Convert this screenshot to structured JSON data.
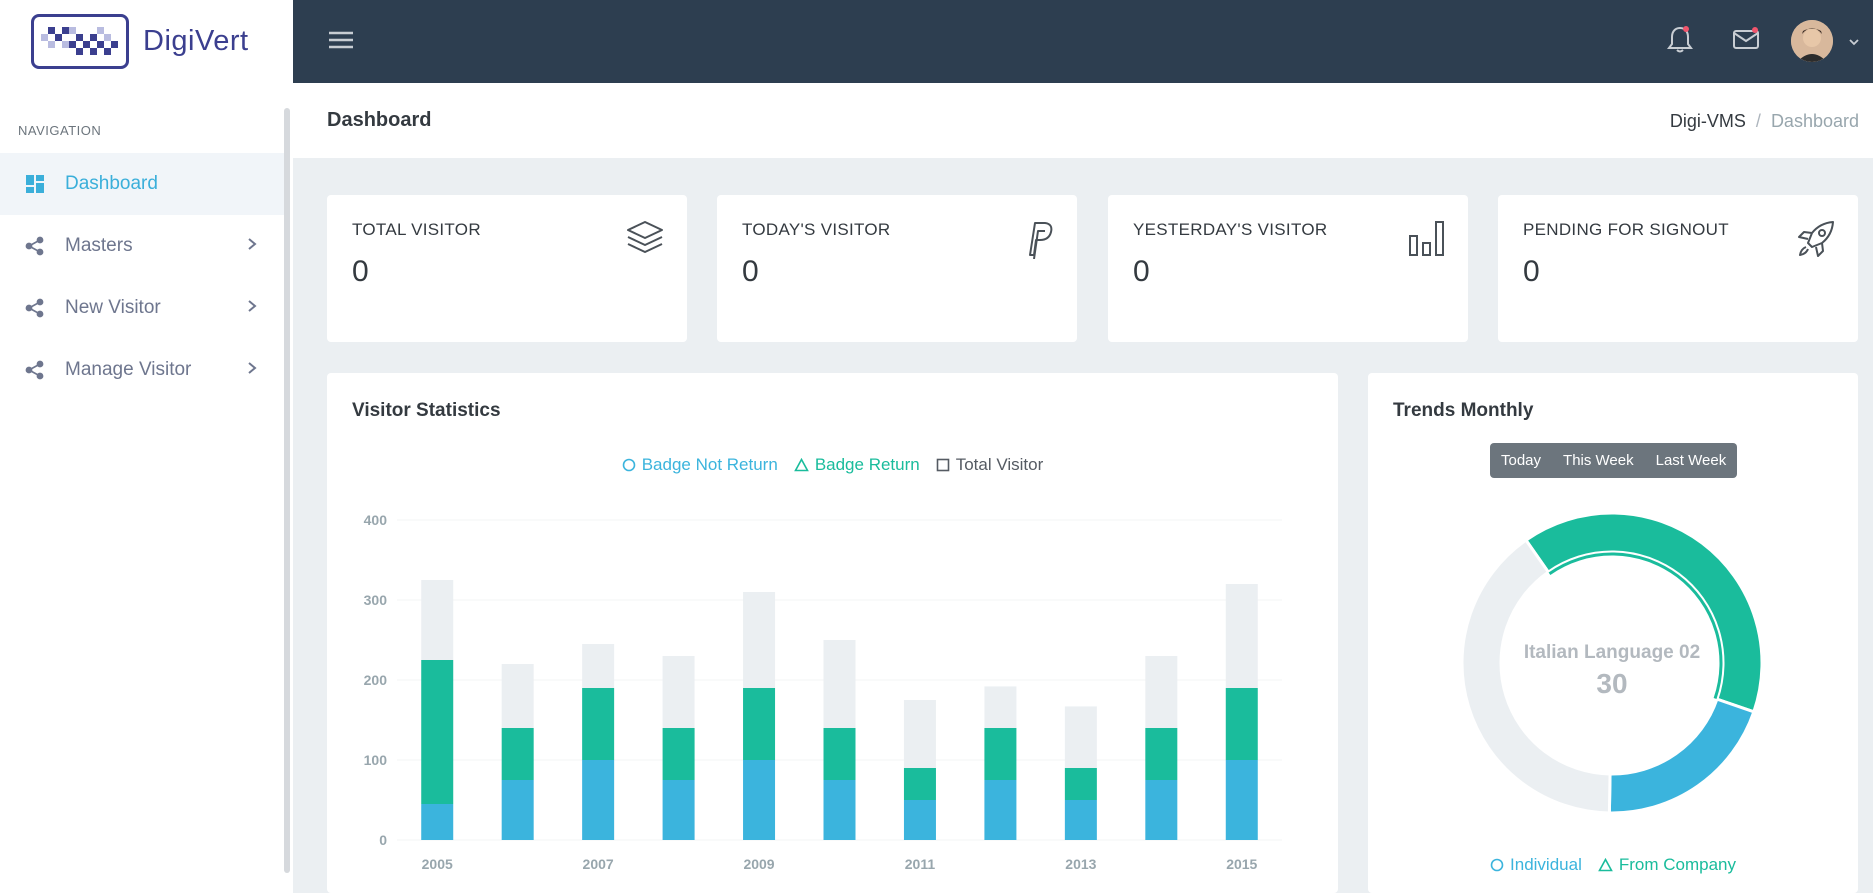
{
  "brand": {
    "name": "DigiVert"
  },
  "sidebar": {
    "section_title": "NAVIGATION",
    "items": [
      {
        "label": "Dashboard",
        "icon": "dashboard-icon",
        "active": true
      },
      {
        "label": "Masters",
        "icon": "share-icon",
        "active": false
      },
      {
        "label": "New Visitor",
        "icon": "share-icon",
        "active": false
      },
      {
        "label": "Manage Visitor",
        "icon": "share-icon",
        "active": false
      }
    ]
  },
  "topbar": {
    "icons": [
      "menu-icon",
      "bell-icon",
      "mail-icon",
      "avatar",
      "chevron-down-icon"
    ]
  },
  "page": {
    "title": "Dashboard",
    "breadcrumb": [
      "Digi-VMS",
      "Dashboard"
    ]
  },
  "stats": [
    {
      "label": "TOTAL VISITOR",
      "value": "0",
      "icon": "layers-icon"
    },
    {
      "label": "TODAY'S VISITOR",
      "value": "0",
      "icon": "paypal-icon"
    },
    {
      "label": "YESTERDAY'S VISITOR",
      "value": "0",
      "icon": "bar-chart-icon"
    },
    {
      "label": "PENDING FOR SIGNOUT",
      "value": "0",
      "icon": "rocket-icon"
    }
  ],
  "visitor_stats": {
    "title": "Visitor Statistics",
    "legend": [
      {
        "label": "Badge Not Return",
        "marker": "circle",
        "color": "#3bb4dd"
      },
      {
        "label": "Badge Return",
        "marker": "triangle",
        "color": "#1abc9c"
      },
      {
        "label": "Total Visitor",
        "marker": "square",
        "color": "#555b63"
      }
    ]
  },
  "trends": {
    "title": "Trends Monthly",
    "buttons": [
      "Today",
      "This Week",
      "Last Week"
    ],
    "center_label": "Italian Language 02",
    "center_value": "30",
    "legend": [
      {
        "label": "Individual",
        "marker": "circle",
        "color": "#3bb4dd"
      },
      {
        "label": "From Company",
        "marker": "triangle",
        "color": "#1abc9c"
      }
    ]
  },
  "chart_data": [
    {
      "type": "bar",
      "stacked": true,
      "title": "Visitor Statistics",
      "categories": [
        "2005",
        "2006",
        "2007",
        "2008",
        "2009",
        "2010",
        "2011",
        "2012",
        "2013",
        "2014",
        "2015"
      ],
      "tick_labels_x": [
        "2005",
        "2007",
        "2009",
        "2011",
        "2013",
        "2015"
      ],
      "yticks": [
        0,
        100,
        200,
        300,
        400
      ],
      "ylim": [
        0,
        400
      ],
      "series": [
        {
          "name": "Badge Not Return",
          "color": "#3bb4dd",
          "values": [
            45,
            75,
            100,
            75,
            100,
            75,
            50,
            75,
            50,
            75,
            100
          ]
        },
        {
          "name": "Badge Return",
          "color": "#1abc9c",
          "values": [
            180,
            65,
            90,
            65,
            90,
            65,
            40,
            65,
            40,
            65,
            90
          ]
        },
        {
          "name": "Total Visitor",
          "color": "#ebeff2",
          "values": [
            100,
            80,
            55,
            90,
            120,
            110,
            85,
            52,
            77,
            90,
            130
          ]
        }
      ],
      "legend": "top-center"
    },
    {
      "type": "pie",
      "donut": true,
      "title": "Trends Monthly",
      "slices": [
        {
          "name": "Individual",
          "value": 20,
          "color": "#3bb4dd"
        },
        {
          "name": "From Company",
          "value": 40,
          "color": "#1abc9c"
        },
        {
          "name": "Other",
          "value": 40,
          "color": "#ebeff2"
        }
      ],
      "legend": "bottom-center"
    }
  ]
}
